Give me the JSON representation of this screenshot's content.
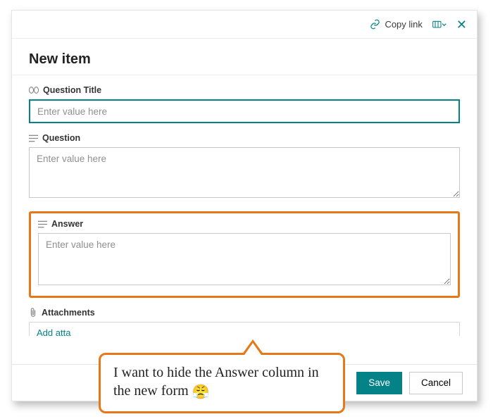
{
  "header": {
    "copy_link": "Copy link"
  },
  "form": {
    "title": "New item",
    "question_title": {
      "label": "Question Title",
      "placeholder": "Enter value here",
      "value": ""
    },
    "question": {
      "label": "Question",
      "placeholder": "Enter value here",
      "value": ""
    },
    "answer": {
      "label": "Answer",
      "placeholder": "Enter value here",
      "value": ""
    },
    "attachments": {
      "label": "Attachments",
      "add_label": "Add atta"
    }
  },
  "footer": {
    "save": "Save",
    "cancel": "Cancel"
  },
  "callout": {
    "text": "I want to hide the Answer column in the new form",
    "emoji": "😤"
  },
  "colors": {
    "accent": "#038387",
    "highlight": "#e77817"
  }
}
